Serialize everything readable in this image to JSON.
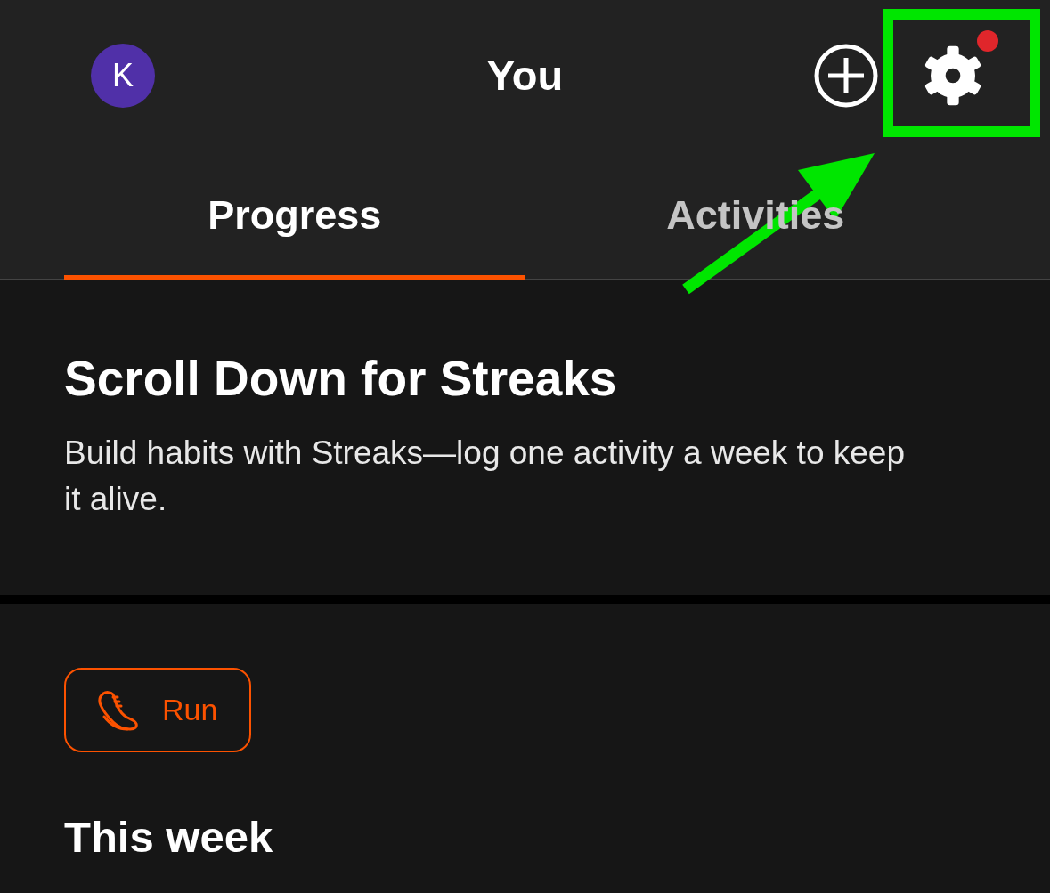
{
  "header": {
    "avatar_initial": "K",
    "title": "You",
    "settings_badge": true
  },
  "tabs": [
    {
      "label": "Progress",
      "selected": true
    },
    {
      "label": "Activities",
      "selected": false
    }
  ],
  "banner": {
    "title": "Scroll Down for Streaks",
    "text": "Build habits with Streaks—log one activity a week to keep it alive."
  },
  "sport_chip": {
    "label": "Run",
    "kind": "run"
  },
  "section": {
    "title": "This week"
  },
  "annotation": {
    "highlight_box": true,
    "arrow": true
  }
}
